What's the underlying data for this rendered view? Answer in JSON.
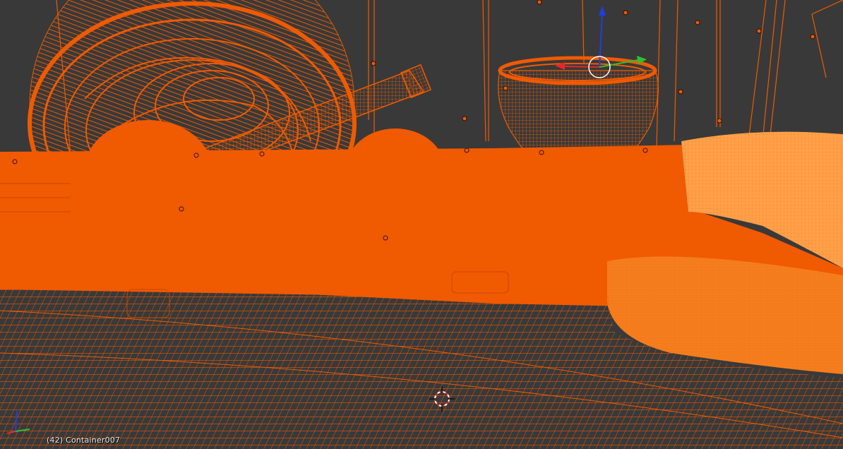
{
  "viewport": {
    "object_label": "(42) Container007",
    "view_mode": "wireframe",
    "selection_color": "#f05a00",
    "selection_light_color": "#ffa14a",
    "background_color": "#393939"
  },
  "icons": {
    "axis": "axis-orientation-icon",
    "cursor": "3d-cursor-icon",
    "gizmo": "transform-manipulator-icon"
  },
  "colors": {
    "x_axis": "#e8262a",
    "y_axis": "#2ec02e",
    "z_axis": "#1f3fe0"
  }
}
